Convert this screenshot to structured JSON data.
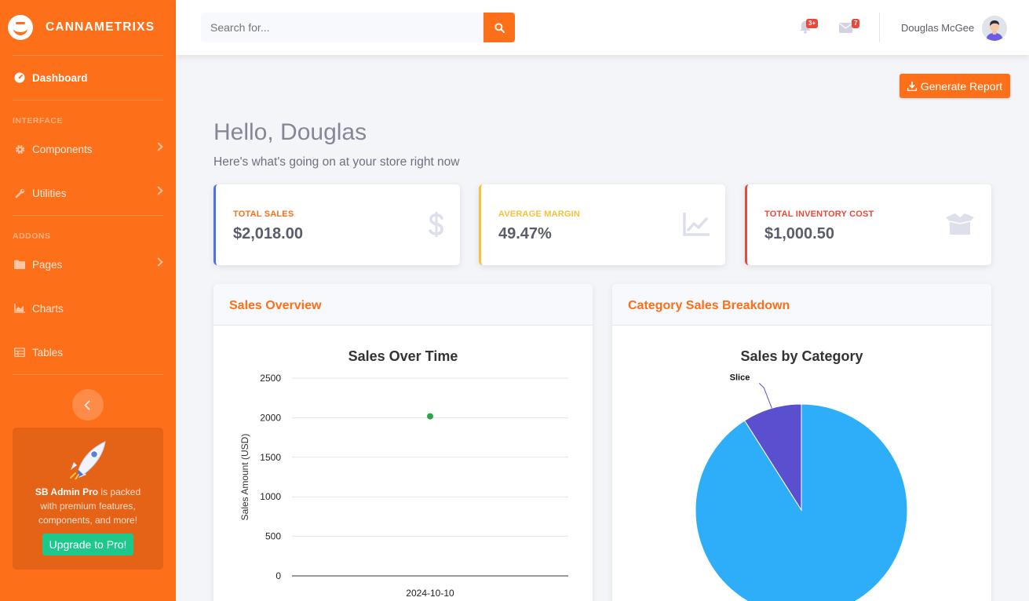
{
  "brand": {
    "name": "CANNAMETRIXS"
  },
  "sidebar": {
    "dashboard": "Dashboard",
    "section_interface": "INTERFACE",
    "components": "Components",
    "utilities": "Utilities",
    "section_addons": "ADDONS",
    "pages": "Pages",
    "charts": "Charts",
    "tables": "Tables",
    "promo": {
      "brand": "SB Admin Pro",
      "text": " is packed with premium features, components, and more!",
      "button": "Upgrade to Pro!"
    }
  },
  "topbar": {
    "search_placeholder": "Search for...",
    "alerts_badge": "3+",
    "messages_badge": "7",
    "user_name": "Douglas McGee"
  },
  "main": {
    "generate_report": "Generate Report",
    "greeting": "Hello, Douglas",
    "subtitle": "Here's what's going on at your store right now"
  },
  "stats": [
    {
      "label": "TOTAL SALES",
      "value": "$2,018.00",
      "color": "#4e73df",
      "label_color": "#fe6f1a"
    },
    {
      "label": "AVERAGE MARGIN",
      "value": "49.47%",
      "color": "#f6c23e",
      "label_color": "#f6c23e"
    },
    {
      "label": "TOTAL INVENTORY COST",
      "value": "$1,000.50",
      "color": "#e74a3b",
      "label_color": "#e74a3b"
    }
  ],
  "cards": {
    "sales_overview": "Sales Overview",
    "category_breakdown": "Category Sales Breakdown"
  },
  "chart_data": [
    {
      "type": "scatter",
      "title": "Sales Over Time",
      "xlabel": "",
      "ylabel": "Sales Amount (USD)",
      "x": [
        "2024-10-10"
      ],
      "values": [
        2018
      ],
      "yticks": [
        0,
        500,
        1000,
        1500,
        2000,
        2500
      ],
      "ylim": [
        0,
        2500
      ],
      "color": "#28a745"
    },
    {
      "type": "pie",
      "title": "Sales by Category",
      "slices": [
        {
          "label": "",
          "value": 91,
          "color": "#2eaef9"
        },
        {
          "label": "Slice",
          "value": 9,
          "color": "#5a4fcf"
        }
      ]
    }
  ]
}
